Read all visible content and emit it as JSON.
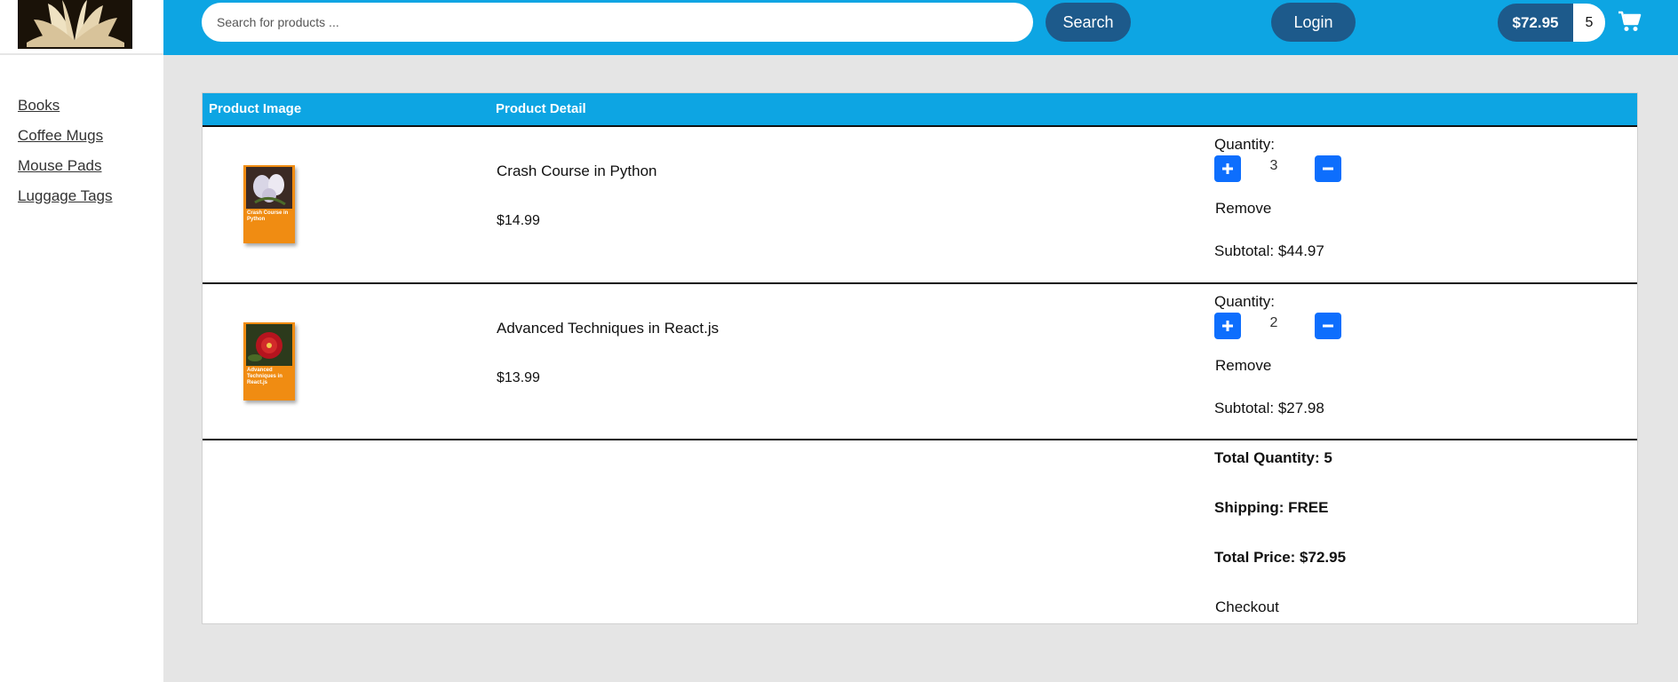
{
  "search": {
    "placeholder": "Search for products ...",
    "button_label": "Search"
  },
  "header": {
    "login_label": "Login",
    "cart_total": "$72.95",
    "cart_count": "5",
    "cart_icon": "shopping-cart-icon"
  },
  "sidebar": {
    "items": [
      {
        "label": "Books"
      },
      {
        "label": "Coffee Mugs"
      },
      {
        "label": "Mouse Pads"
      },
      {
        "label": "Luggage Tags"
      }
    ]
  },
  "table": {
    "headers": [
      "Product Image",
      "Product Detail"
    ]
  },
  "cart_items": [
    {
      "name": "Crash Course in Python",
      "price": "$14.99",
      "quantity_label": "Quantity:",
      "quantity": "3",
      "remove_label": "Remove",
      "subtotal": "Subtotal: $44.97",
      "cover_title": "Crash Course in Python"
    },
    {
      "name": "Advanced Techniques in React.js",
      "price": "$13.99",
      "quantity_label": "Quantity:",
      "quantity": "2",
      "remove_label": "Remove",
      "subtotal": "Subtotal: $27.98",
      "cover_title": "Advanced Techniques in React.js"
    }
  ],
  "summary": {
    "total_quantity": "Total Quantity: 5",
    "shipping": "Shipping: FREE",
    "total_price": "Total Price: $72.95",
    "checkout_label": "Checkout"
  },
  "colors": {
    "header_bg": "#0da5e3",
    "button_dark": "#1d5a8b",
    "qty_button": "#0d6efd",
    "main_bg": "#e5e5e5"
  }
}
